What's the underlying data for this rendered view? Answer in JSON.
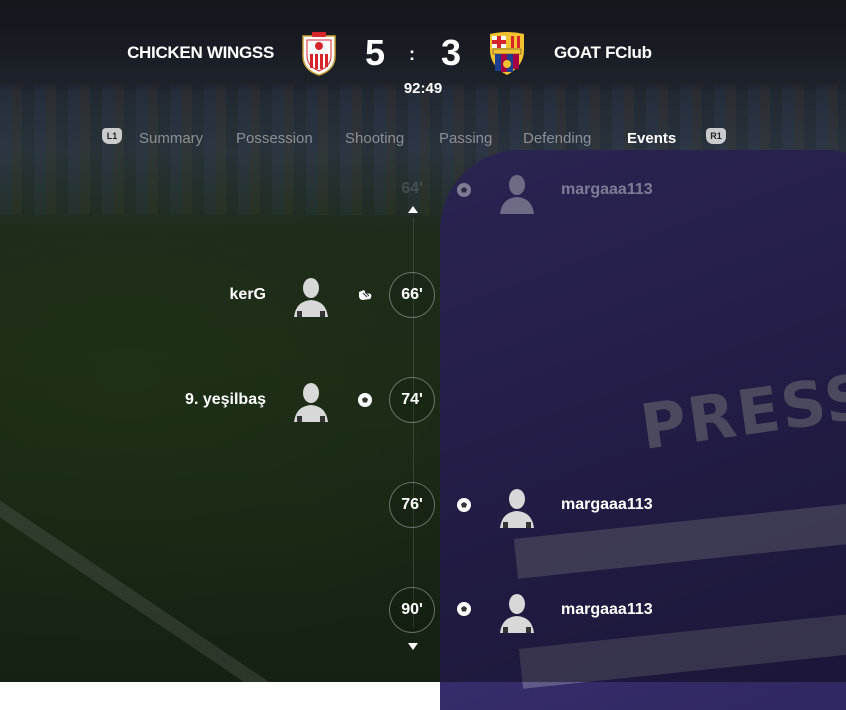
{
  "match": {
    "home_team": "CHICKEN WINGSS",
    "away_team": "GOAT FClub",
    "home_score": "5",
    "away_score": "3",
    "separator": ":",
    "clock": "92:49"
  },
  "tabs": {
    "left_button": "L1",
    "right_button": "R1",
    "items": [
      {
        "label": "Summary"
      },
      {
        "label": "Possession"
      },
      {
        "label": "Shooting"
      },
      {
        "label": "Passing"
      },
      {
        "label": "Defending"
      },
      {
        "label": "Events"
      }
    ],
    "active": "Events"
  },
  "events": [
    {
      "minute": "64'",
      "side": "away",
      "player": "margaaa113",
      "type": "goal"
    },
    {
      "minute": "66'",
      "side": "home",
      "player": "kerG",
      "type": "assist"
    },
    {
      "minute": "74'",
      "side": "home",
      "player": "9. yeşilbaş",
      "type": "goal"
    },
    {
      "minute": "76'",
      "side": "away",
      "player": "margaaa113",
      "type": "goal"
    },
    {
      "minute": "90'",
      "side": "away",
      "player": "margaaa113",
      "type": "goal"
    }
  ],
  "colors": {
    "home_crest": "#d6262c",
    "away_crest_blue": "#1d3f8f",
    "away_crest_red": "#a50044",
    "gold": "#f2c230"
  }
}
